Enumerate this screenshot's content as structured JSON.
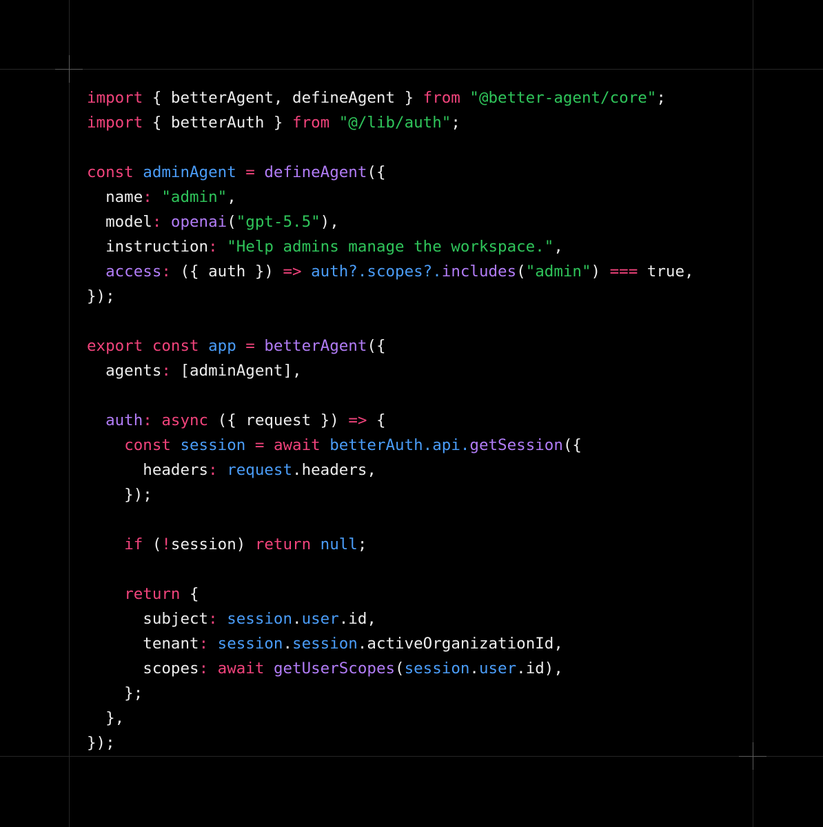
{
  "colors": {
    "plain": "#ececec",
    "keyword": "#f0437b",
    "string": "#2fc45a",
    "func": "#b17cf6",
    "ident": "#4a9cf7",
    "background": "#000000",
    "guide": "#262626"
  },
  "code": {
    "lines": [
      [
        {
          "t": "import",
          "c": "keyword"
        },
        {
          "t": " { betterAgent, defineAgent } ",
          "c": "plain"
        },
        {
          "t": "from",
          "c": "keyword"
        },
        {
          "t": " ",
          "c": "plain"
        },
        {
          "t": "\"@better-agent/core\"",
          "c": "string"
        },
        {
          "t": ";",
          "c": "plain"
        }
      ],
      [
        {
          "t": "import",
          "c": "keyword"
        },
        {
          "t": " { betterAuth } ",
          "c": "plain"
        },
        {
          "t": "from",
          "c": "keyword"
        },
        {
          "t": " ",
          "c": "plain"
        },
        {
          "t": "\"@/lib/auth\"",
          "c": "string"
        },
        {
          "t": ";",
          "c": "plain"
        }
      ],
      [],
      [
        {
          "t": "const",
          "c": "keyword"
        },
        {
          "t": " ",
          "c": "plain"
        },
        {
          "t": "adminAgent",
          "c": "ident"
        },
        {
          "t": " ",
          "c": "plain"
        },
        {
          "t": "=",
          "c": "keyword"
        },
        {
          "t": " ",
          "c": "plain"
        },
        {
          "t": "defineAgent",
          "c": "func"
        },
        {
          "t": "({",
          "c": "plain"
        }
      ],
      [
        {
          "t": "  name",
          "c": "plain"
        },
        {
          "t": ":",
          "c": "keyword"
        },
        {
          "t": " ",
          "c": "plain"
        },
        {
          "t": "\"admin\"",
          "c": "string"
        },
        {
          "t": ",",
          "c": "plain"
        }
      ],
      [
        {
          "t": "  model",
          "c": "plain"
        },
        {
          "t": ":",
          "c": "keyword"
        },
        {
          "t": " ",
          "c": "plain"
        },
        {
          "t": "openai",
          "c": "func"
        },
        {
          "t": "(",
          "c": "plain"
        },
        {
          "t": "\"gpt-5.5\"",
          "c": "string"
        },
        {
          "t": "),",
          "c": "plain"
        }
      ],
      [
        {
          "t": "  instruction",
          "c": "plain"
        },
        {
          "t": ":",
          "c": "keyword"
        },
        {
          "t": " ",
          "c": "plain"
        },
        {
          "t": "\"Help admins manage the workspace.\"",
          "c": "string"
        },
        {
          "t": ",",
          "c": "plain"
        }
      ],
      [
        {
          "t": "  access",
          "c": "func"
        },
        {
          "t": ":",
          "c": "keyword"
        },
        {
          "t": " ({ auth }) ",
          "c": "plain"
        },
        {
          "t": "=>",
          "c": "keyword"
        },
        {
          "t": " ",
          "c": "plain"
        },
        {
          "t": "auth?.scopes?.",
          "c": "ident"
        },
        {
          "t": "includes",
          "c": "func"
        },
        {
          "t": "(",
          "c": "plain"
        },
        {
          "t": "\"admin\"",
          "c": "string"
        },
        {
          "t": ") ",
          "c": "plain"
        },
        {
          "t": "===",
          "c": "keyword"
        },
        {
          "t": " true,",
          "c": "plain"
        }
      ],
      [
        {
          "t": "});",
          "c": "plain"
        }
      ],
      [],
      [
        {
          "t": "export",
          "c": "keyword"
        },
        {
          "t": " ",
          "c": "plain"
        },
        {
          "t": "const",
          "c": "keyword"
        },
        {
          "t": " ",
          "c": "plain"
        },
        {
          "t": "app",
          "c": "ident"
        },
        {
          "t": " ",
          "c": "plain"
        },
        {
          "t": "=",
          "c": "keyword"
        },
        {
          "t": " ",
          "c": "plain"
        },
        {
          "t": "betterAgent",
          "c": "func"
        },
        {
          "t": "({",
          "c": "plain"
        }
      ],
      [
        {
          "t": "  agents",
          "c": "plain"
        },
        {
          "t": ":",
          "c": "keyword"
        },
        {
          "t": " [adminAgent],",
          "c": "plain"
        }
      ],
      [],
      [
        {
          "t": "  auth",
          "c": "func"
        },
        {
          "t": ":",
          "c": "keyword"
        },
        {
          "t": " ",
          "c": "plain"
        },
        {
          "t": "async",
          "c": "keyword"
        },
        {
          "t": " ({ request }) ",
          "c": "plain"
        },
        {
          "t": "=>",
          "c": "keyword"
        },
        {
          "t": " {",
          "c": "plain"
        }
      ],
      [
        {
          "t": "    ",
          "c": "plain"
        },
        {
          "t": "const",
          "c": "keyword"
        },
        {
          "t": " ",
          "c": "plain"
        },
        {
          "t": "session",
          "c": "ident"
        },
        {
          "t": " ",
          "c": "plain"
        },
        {
          "t": "=",
          "c": "keyword"
        },
        {
          "t": " ",
          "c": "plain"
        },
        {
          "t": "await",
          "c": "keyword"
        },
        {
          "t": " ",
          "c": "plain"
        },
        {
          "t": "betterAuth.api.",
          "c": "ident"
        },
        {
          "t": "getSession",
          "c": "func"
        },
        {
          "t": "({",
          "c": "plain"
        }
      ],
      [
        {
          "t": "      headers",
          "c": "plain"
        },
        {
          "t": ":",
          "c": "keyword"
        },
        {
          "t": " ",
          "c": "plain"
        },
        {
          "t": "request",
          "c": "ident"
        },
        {
          "t": ".headers,",
          "c": "plain"
        }
      ],
      [
        {
          "t": "    });",
          "c": "plain"
        }
      ],
      [],
      [
        {
          "t": "    ",
          "c": "plain"
        },
        {
          "t": "if",
          "c": "keyword"
        },
        {
          "t": " (",
          "c": "plain"
        },
        {
          "t": "!",
          "c": "keyword"
        },
        {
          "t": "session) ",
          "c": "plain"
        },
        {
          "t": "return",
          "c": "keyword"
        },
        {
          "t": " ",
          "c": "plain"
        },
        {
          "t": "null",
          "c": "ident"
        },
        {
          "t": ";",
          "c": "plain"
        }
      ],
      [],
      [
        {
          "t": "    ",
          "c": "plain"
        },
        {
          "t": "return",
          "c": "keyword"
        },
        {
          "t": " {",
          "c": "plain"
        }
      ],
      [
        {
          "t": "      subject",
          "c": "plain"
        },
        {
          "t": ":",
          "c": "keyword"
        },
        {
          "t": " ",
          "c": "plain"
        },
        {
          "t": "session",
          "c": "ident"
        },
        {
          "t": ".",
          "c": "plain"
        },
        {
          "t": "user",
          "c": "ident"
        },
        {
          "t": ".id,",
          "c": "plain"
        }
      ],
      [
        {
          "t": "      tenant",
          "c": "plain"
        },
        {
          "t": ":",
          "c": "keyword"
        },
        {
          "t": " ",
          "c": "plain"
        },
        {
          "t": "session",
          "c": "ident"
        },
        {
          "t": ".",
          "c": "plain"
        },
        {
          "t": "session",
          "c": "ident"
        },
        {
          "t": ".activeOrganizationId,",
          "c": "plain"
        }
      ],
      [
        {
          "t": "      scopes",
          "c": "plain"
        },
        {
          "t": ":",
          "c": "keyword"
        },
        {
          "t": " ",
          "c": "plain"
        },
        {
          "t": "await",
          "c": "keyword"
        },
        {
          "t": " ",
          "c": "plain"
        },
        {
          "t": "getUserScopes",
          "c": "func"
        },
        {
          "t": "(",
          "c": "plain"
        },
        {
          "t": "session",
          "c": "ident"
        },
        {
          "t": ".",
          "c": "plain"
        },
        {
          "t": "user",
          "c": "ident"
        },
        {
          "t": ".id),",
          "c": "plain"
        }
      ],
      [
        {
          "t": "    };",
          "c": "plain"
        }
      ],
      [
        {
          "t": "  },",
          "c": "plain"
        }
      ],
      [
        {
          "t": "});",
          "c": "plain"
        }
      ]
    ]
  }
}
